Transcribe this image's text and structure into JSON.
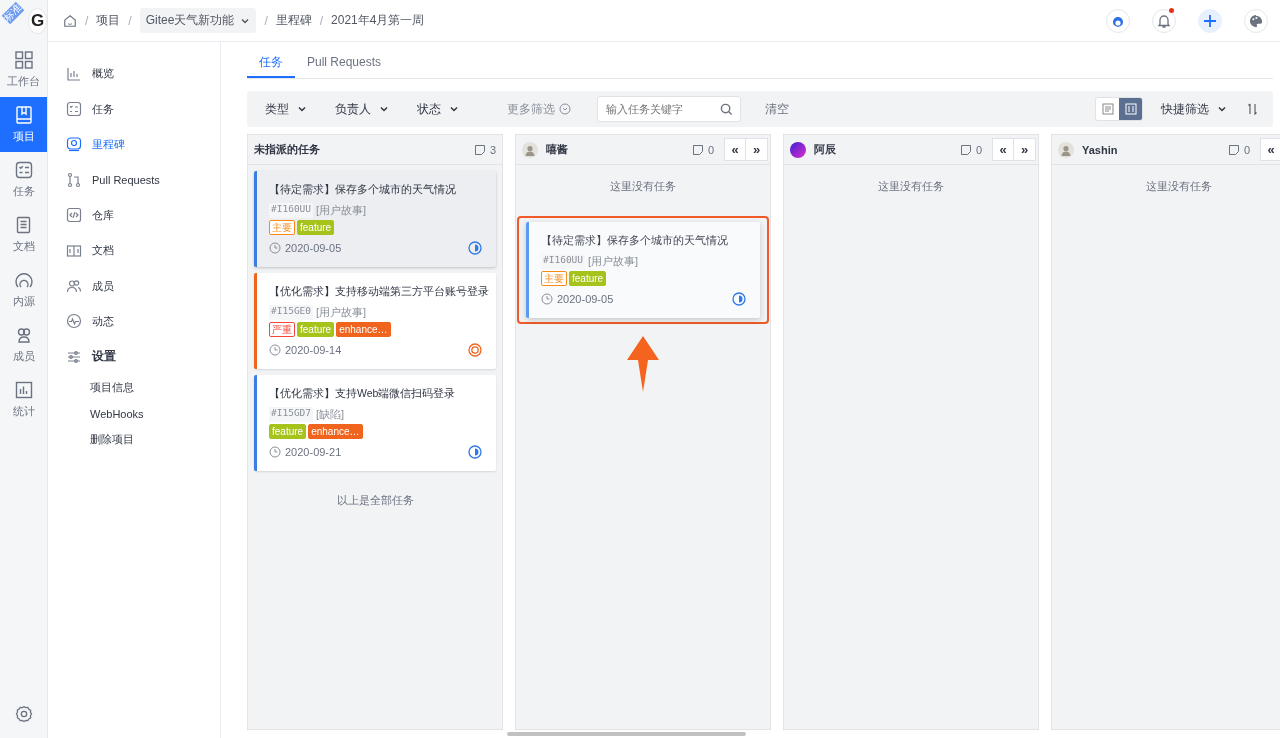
{
  "rail": {
    "badge": "标准",
    "logo": "G",
    "items": [
      {
        "label": "工作台",
        "selected": false
      },
      {
        "label": "项目",
        "selected": true
      },
      {
        "label": "任务",
        "selected": false
      },
      {
        "label": "文档",
        "selected": false
      },
      {
        "label": "内源",
        "selected": false
      },
      {
        "label": "成员",
        "selected": false
      },
      {
        "label": "统计",
        "selected": false
      }
    ]
  },
  "breadcrumb": [
    {
      "separator": "/",
      "label": "项目",
      "kind": "link"
    },
    {
      "separator": "/",
      "label": "Gitee天气新功能",
      "kind": "dropdown"
    },
    {
      "separator": "/",
      "label": "里程碑",
      "kind": "link"
    },
    {
      "separator": "/",
      "label": "2021年4月第一周",
      "kind": "current"
    }
  ],
  "header": {
    "notification_unread": true
  },
  "sidebar": {
    "items": [
      {
        "label": "概览",
        "selected": false
      },
      {
        "label": "任务",
        "selected": false
      },
      {
        "label": "里程碑",
        "selected": true
      },
      {
        "label": "Pull Requests",
        "selected": false
      },
      {
        "label": "仓库",
        "selected": false
      },
      {
        "label": "文档",
        "selected": false
      },
      {
        "label": "成员",
        "selected": false
      },
      {
        "label": "动态",
        "selected": false
      },
      {
        "label": "设置",
        "selected": false,
        "children": [
          {
            "label": "项目信息"
          },
          {
            "label": "WebHooks"
          },
          {
            "label": "删除项目"
          }
        ]
      }
    ]
  },
  "tabs": [
    {
      "label": "任务",
      "selected": true
    },
    {
      "label": "Pull Requests",
      "selected": false
    }
  ],
  "filters": {
    "dropdowns": [
      "类型",
      "负责人",
      "状态"
    ],
    "more": "更多筛选",
    "search": {
      "placeholder": "输入任务关键字"
    },
    "clear": "清空",
    "views": [
      {
        "kind": "list",
        "selected": false
      },
      {
        "kind": "board",
        "selected": true
      }
    ],
    "quick": "快捷筛选"
  },
  "columns": [
    {
      "title": "未指派的任务",
      "count": "3",
      "footer": "以上是全部任务",
      "cards": [
        {
          "title": "【待定需求】保存多个城市的天气情况",
          "id": "#I160UU",
          "type": "[用户故事]",
          "tags": [
            {
              "label": "主要",
              "kind": "outline",
              "color": "#fa8c16"
            },
            {
              "label": "feature",
              "kind": "solid",
              "color": "#a6c31c"
            }
          ],
          "date": "2020-09-05",
          "in_progress": true,
          "color": "#3b7de0",
          "dragging": true
        },
        {
          "title": "【优化需求】支持移动端第三方平台账号登录",
          "id": "#I15GE0",
          "type": "[用户故事]",
          "tags": [
            {
              "label": "严重",
              "kind": "outline",
              "color": "#f5483b"
            },
            {
              "label": "feature",
              "kind": "solid",
              "color": "#a6c31c"
            },
            {
              "label": "enhance…",
              "kind": "solid",
              "color": "#f0641e"
            }
          ],
          "date": "2020-09-14",
          "in_progress": false,
          "color": "#f0641e",
          "dragging": false
        },
        {
          "title": "【优化需求】支持Web端微信扫码登录",
          "id": "#I15GD7",
          "type": "[缺陷]",
          "tags": [
            {
              "label": "feature",
              "kind": "solid",
              "color": "#a6c31c"
            },
            {
              "label": "enhance…",
              "kind": "solid",
              "color": "#f0641e"
            }
          ],
          "date": "2020-09-21",
          "in_progress": true,
          "color": "#3b7de0",
          "dragging": false
        }
      ]
    },
    {
      "title": "嘻酱",
      "count": "0",
      "nav": [
        "«",
        "»"
      ],
      "empty": "这里没有任务",
      "drop_preview": {
        "title": "【待定需求】保存多个城市的天气情况",
        "id": "#I160UU",
        "type": "[用户故事]",
        "tags": [
          {
            "label": "主要",
            "kind": "outline",
            "color": "#fa8c16"
          },
          {
            "label": "feature",
            "kind": "solid",
            "color": "#a6c31c"
          }
        ],
        "date": "2020-09-05",
        "in_progress": true,
        "color": "#5b9bef"
      }
    },
    {
      "title": "阿辰",
      "count": "0",
      "nav": [
        "«",
        "»"
      ],
      "empty": "这里没有任务"
    },
    {
      "title": "Yashin",
      "count": "0",
      "nav": [
        "«"
      ],
      "empty": "这里没有任务"
    }
  ]
}
